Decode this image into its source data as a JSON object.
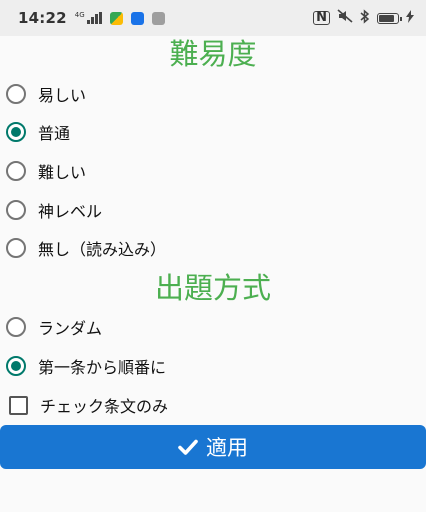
{
  "status_bar": {
    "time": "14:22",
    "network": "4G",
    "right_icons": [
      "nfc-icon",
      "mute-icon",
      "bluetooth-icon",
      "battery-icon",
      "charging-icon"
    ]
  },
  "difficulty": {
    "title": "難易度",
    "options": [
      {
        "label": "易しい",
        "selected": false
      },
      {
        "label": "普通",
        "selected": true
      },
      {
        "label": "難しい",
        "selected": false
      },
      {
        "label": "神レベル",
        "selected": false
      },
      {
        "label": "無し（読み込み）",
        "selected": false
      }
    ]
  },
  "question_format": {
    "title": "出題方式",
    "options": [
      {
        "label": "ランダム",
        "selected": false
      },
      {
        "label": "第一条から順番に",
        "selected": true
      }
    ],
    "checkbox": {
      "label": "チェック条文のみ",
      "checked": false
    }
  },
  "apply_button": {
    "label": "適用",
    "icon": "check-icon"
  },
  "colors": {
    "title_green": "#4caf50",
    "radio_selected": "#00796b",
    "button_blue": "#1976d2"
  }
}
